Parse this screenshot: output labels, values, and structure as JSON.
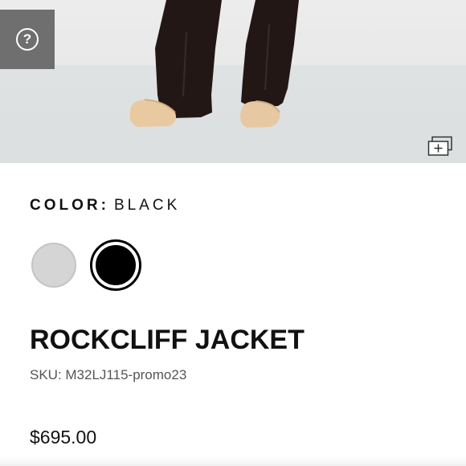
{
  "product_image": {
    "alt": "",
    "help_icon": "question-circle-icon",
    "gallery_icon": "image-gallery-plus-icon"
  },
  "color": {
    "label": "COLOR:",
    "value": "BLACK",
    "swatches": [
      {
        "name": "gray",
        "hex": "#d5d5d5",
        "selected": false
      },
      {
        "name": "black",
        "hex": "#000000",
        "selected": true
      }
    ]
  },
  "product": {
    "title": "ROCKCLIFF JACKET",
    "sku": "SKU: M32LJ115-promo23",
    "price": "$695.00"
  }
}
